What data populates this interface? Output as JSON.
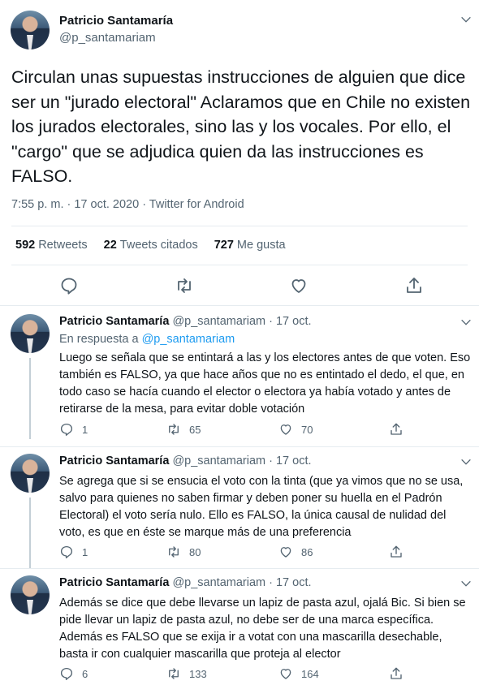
{
  "main_tweet": {
    "author_name": "Patricio Santamaría",
    "author_handle": "@p_santamariam",
    "text": "Circulan unas supuestas instrucciones de alguien que dice ser un \"jurado electoral\" Aclaramos que en Chile no existen los jurados electorales, sino las y los vocales. Por ello,  el \"cargo\" que se adjudica quien da las instrucciones es FALSO.",
    "meta": "7:55 p. m. · 17 oct. 2020 · Twitter for Android",
    "stats": {
      "retweets_count": "592",
      "retweets_label": "Retweets",
      "quotes_count": "22",
      "quotes_label": "Tweets citados",
      "likes_count": "727",
      "likes_label": "Me gusta"
    }
  },
  "replies": [
    {
      "author_name": "Patricio Santamaría",
      "author_handle": "@p_santamariam",
      "date": "· 17 oct.",
      "reply_prefix": "En respuesta a ",
      "reply_to": "@p_santamariam",
      "text": "Luego se señala que se entintará a las y los electores antes de que voten. Eso también es FALSO, ya que hace años que no es entintado el dedo, el que, en todo caso se hacía cuando el elector o electora ya había votado y antes de retirarse de la mesa, para evitar doble votación",
      "replies_count": "1",
      "retweets_count": "65",
      "likes_count": "70"
    },
    {
      "author_name": "Patricio Santamaría",
      "author_handle": "@p_santamariam",
      "date": "· 17 oct.",
      "text": "Se agrega que si se ensucia el voto con la tinta (que ya vimos que no se usa, salvo para quienes no saben firmar y deben poner su huella en el Padrón Electoral) el voto sería nulo. Ello es FALSO, la única causal de nulidad del voto, es que en éste se marque más de una preferencia",
      "replies_count": "1",
      "retweets_count": "80",
      "likes_count": "86"
    },
    {
      "author_name": "Patricio Santamaría",
      "author_handle": "@p_santamariam",
      "date": "· 17 oct.",
      "text": "Además se dice que debe llevarse un lapiz de pasta azul, ojalá Bic. Si bien se pide llevar un lapiz de pasta azul, no debe ser de una marca específica. Además es FALSO que se exija ir a votat con una mascarilla desechable, basta ir con cualquier mascarilla que proteja al elector",
      "replies_count": "6",
      "retweets_count": "133",
      "likes_count": "164"
    }
  ],
  "icons": {
    "reply": "reply-bubble-icon",
    "retweet": "retweet-icon",
    "like": "heart-icon",
    "share": "share-icon",
    "more": "chevron-down-icon"
  },
  "colors": {
    "text": "#0f1419",
    "secondary": "#536471",
    "link": "#1d9bf0",
    "divider": "#e6ecf0"
  }
}
